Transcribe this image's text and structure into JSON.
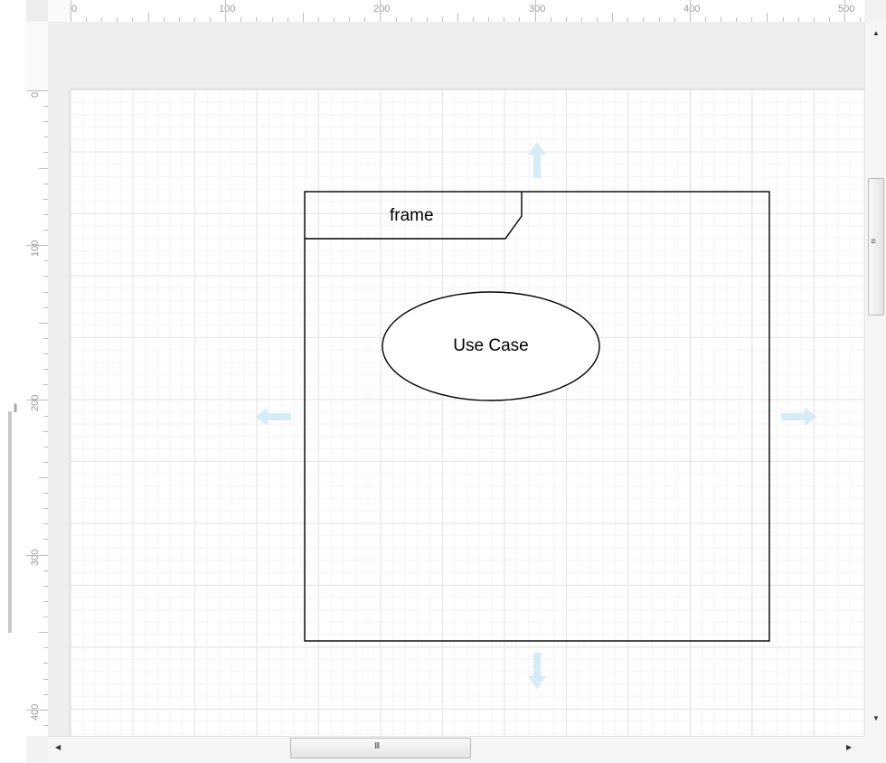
{
  "rulers": {
    "horizontal_labels": [
      "0",
      "100",
      "200",
      "300",
      "400",
      "500"
    ],
    "vertical_labels": [
      "0",
      "100",
      "200",
      "300",
      "400"
    ]
  },
  "diagram": {
    "frame_label": "frame",
    "use_case_label": "Use Case"
  },
  "colors": {
    "hover_arrow": "#d6ecf7",
    "grid_major": "#e6e6e6",
    "grid_minor": "#f4f4f4"
  },
  "icons": {
    "vertical_grip": "≡",
    "horizontal_grip": "III",
    "left_panel_grip": "||",
    "scroll_up": "▲",
    "scroll_down": "▼",
    "scroll_left": "◀",
    "scroll_right": "▶"
  }
}
